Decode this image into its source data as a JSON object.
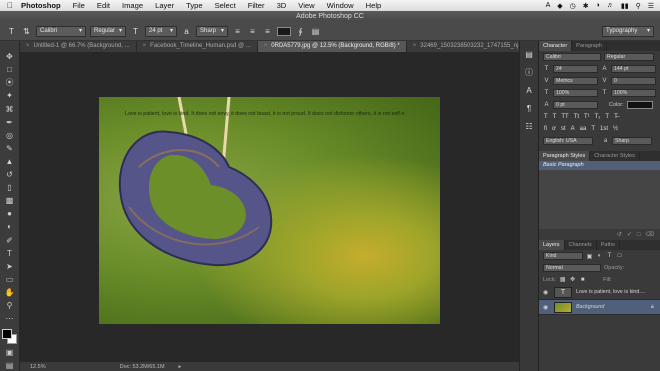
{
  "menubar": {
    "app_name": "Photoshop",
    "items": [
      "File",
      "Edit",
      "Image",
      "Layer",
      "Type",
      "Select",
      "Filter",
      "3D",
      "View",
      "Window",
      "Help"
    ]
  },
  "window_title": "Adobe Photoshop CC",
  "options": {
    "font_family": "Calibri",
    "font_style": "Regular",
    "font_size": "24 pt",
    "antialias": "Sharp",
    "workspace": "Typography"
  },
  "tabs": [
    {
      "label": "Untitled-1 @ 66.7% (Background, ..."
    },
    {
      "label": "Facebook_Timeline_Human.psd @ ..."
    },
    {
      "label": "0RDA5779.jpg @ 12.5% (Background, RGB/8) *"
    },
    {
      "label": "32469_1503238503232_1747155_nj"
    }
  ],
  "canvas": {
    "text_line": "Love is patient, love is kind. It does not envy, it does not boast, it is not proud. It does not dishonor others, it is not self-s"
  },
  "status": {
    "zoom": "12.5%",
    "doc": "Doc: 53.2M/65.1M"
  },
  "character_panel": {
    "tabs": [
      "Character",
      "Paragraph"
    ],
    "font_family": "Calibri",
    "font_style": "Regular",
    "size": "24",
    "leading": "144 pt",
    "kerning": "Metrics",
    "tracking": "0",
    "vertical_scale": "100%",
    "horizontal_scale": "100%",
    "baseline": "0 pt",
    "color_label": "Color:",
    "language": "English: USA",
    "aa": "Sharp",
    "type_icons": [
      "T",
      "T",
      "TT",
      "Tt",
      "T¹",
      "T₁",
      "T",
      "T̶"
    ],
    "ot_icons": [
      "fi",
      "ơ",
      "st",
      "A",
      "aa",
      "T",
      "1st",
      "½"
    ]
  },
  "styles_panel": {
    "tabs": [
      "Paragraph Styles",
      "Character Styles"
    ],
    "items": [
      "Basic Paragraph"
    ]
  },
  "layers_panel": {
    "tabs": [
      "Layers",
      "Channels",
      "Paths"
    ],
    "kind": "Kind",
    "blend": "Normal",
    "opacity_label": "Opacity:",
    "lock_label": "Lock:",
    "fill_label": "Fill:",
    "layers": [
      {
        "name": "Love is patient, love is kind....",
        "type": "text"
      },
      {
        "name": "Background",
        "type": "image"
      }
    ]
  },
  "colors": {
    "accent_selection": "#50607a"
  }
}
